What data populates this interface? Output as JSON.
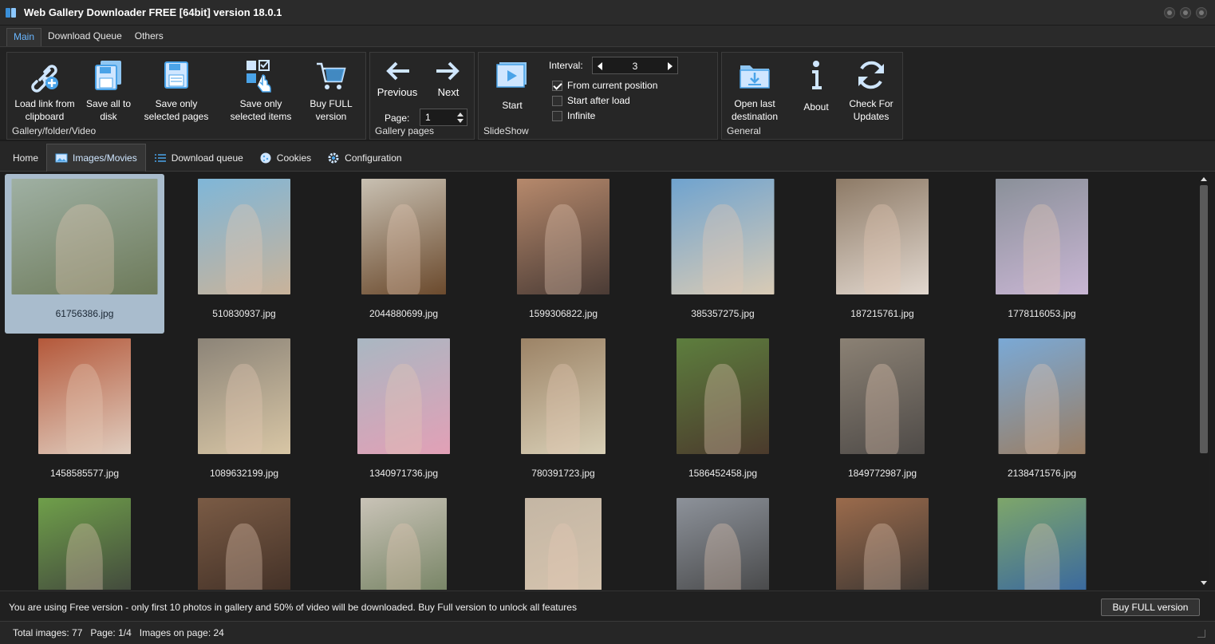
{
  "window": {
    "title": "Web Gallery Downloader FREE [64bit] version 18.0.1"
  },
  "ribbon_tabs": [
    {
      "label": "Main",
      "active": true
    },
    {
      "label": "Download Queue",
      "active": false
    },
    {
      "label": "Others",
      "active": false
    }
  ],
  "ribbon": {
    "gallery_group": {
      "label": "Gallery/folder/Video",
      "load_link": "Load link from clipboard",
      "save_all_1": "Save all to",
      "save_all_2": "disk",
      "save_pages_1": "Save only",
      "save_pages_2": "selected pages",
      "save_items_1": "Save only",
      "save_items_2": "selected items",
      "buy_full_1": "Buy FULL",
      "buy_full_2": "version",
      "load_link_1": "Load link from",
      "load_link_2": "clipboard"
    },
    "pages_group": {
      "label": "Gallery pages",
      "previous": "Previous",
      "next": "Next",
      "page_label": "Page:",
      "page_value": "1"
    },
    "slideshow_group": {
      "label": "SlideShow",
      "start": "Start",
      "interval_label": "Interval:",
      "interval_value": "3",
      "from_current": "From current position",
      "from_current_checked": true,
      "start_after_load": "Start after load",
      "start_after_load_checked": false,
      "infinite": "Infinite",
      "infinite_checked": false
    },
    "general_group": {
      "label": "General",
      "open_last_1": "Open last",
      "open_last_2": "destination",
      "about": "About",
      "check_updates_1": "Check For",
      "check_updates_2": "Updates"
    }
  },
  "content_tabs": [
    {
      "label": "Home",
      "icon": "none",
      "active": false
    },
    {
      "label": "Images/Movies",
      "icon": "image-icon",
      "active": true
    },
    {
      "label": "Download queue",
      "icon": "list-icon",
      "active": false
    },
    {
      "label": "Cookies",
      "icon": "cookie-icon",
      "active": false
    },
    {
      "label": "Configuration",
      "icon": "gear-icon",
      "active": false
    }
  ],
  "gallery": {
    "rows": [
      [
        {
          "file": "61756386.jpg",
          "selected": true,
          "colors": [
            "#9fb0a3",
            "#6d7a5a"
          ]
        },
        {
          "file": "510830937.jpg",
          "selected": false,
          "colors": [
            "#7fb6d8",
            "#c9b39a"
          ]
        },
        {
          "file": "2044880699.jpg",
          "selected": false,
          "colors": [
            "#c8c0b2",
            "#6b4a2d"
          ]
        },
        {
          "file": "1599306822.jpg",
          "selected": false,
          "colors": [
            "#b6896c",
            "#4a3b35"
          ]
        },
        {
          "file": "385357275.jpg",
          "selected": false,
          "colors": [
            "#6fa3cf",
            "#d9cbb5"
          ]
        },
        {
          "file": "187215761.jpg",
          "selected": false,
          "colors": [
            "#8d7a66",
            "#e2d8cf"
          ]
        },
        {
          "file": "1778116053.jpg",
          "selected": false,
          "colors": [
            "#8a9099",
            "#c9b6d4"
          ]
        }
      ],
      [
        {
          "file": "1458585577.jpg",
          "selected": false,
          "colors": [
            "#b4583a",
            "#e0cdbf"
          ]
        },
        {
          "file": "1089632199.jpg",
          "selected": false,
          "colors": [
            "#8c8478",
            "#d8c6a5"
          ]
        },
        {
          "file": "1340971736.jpg",
          "selected": false,
          "colors": [
            "#a9b7c2",
            "#e2a0b6"
          ]
        },
        {
          "file": "780391723.jpg",
          "selected": false,
          "colors": [
            "#9c8366",
            "#d8cfb6"
          ]
        },
        {
          "file": "1586452458.jpg",
          "selected": false,
          "colors": [
            "#5d7e3e",
            "#4b3a2c"
          ]
        },
        {
          "file": "1849772987.jpg",
          "selected": false,
          "colors": [
            "#8b8174",
            "#4f4b48"
          ]
        },
        {
          "file": "2138471576.jpg",
          "selected": false,
          "colors": [
            "#7aa9d6",
            "#9a7e64"
          ]
        }
      ],
      [
        {
          "file": "",
          "selected": false,
          "colors": [
            "#6f9f4a",
            "#3b3b3b"
          ]
        },
        {
          "file": "",
          "selected": false,
          "colors": [
            "#7a5b45",
            "#3a2a22"
          ]
        },
        {
          "file": "",
          "selected": false,
          "colors": [
            "#c9c3b7",
            "#6a7a58"
          ]
        },
        {
          "file": "",
          "selected": false,
          "colors": [
            "#c4b6a4",
            "#d8c6b0"
          ]
        },
        {
          "file": "",
          "selected": false,
          "colors": [
            "#8d929a",
            "#3d3d3d"
          ]
        },
        {
          "file": "",
          "selected": false,
          "colors": [
            "#9b6b4c",
            "#2e2e2e"
          ]
        },
        {
          "file": "",
          "selected": false,
          "colors": [
            "#7ea66a",
            "#2e5ea8"
          ]
        }
      ]
    ]
  },
  "notice": {
    "text": "You are using Free version - only first 10 photos in gallery and 50% of video will be downloaded. Buy Full version to unlock all features",
    "button": "Buy FULL version"
  },
  "status": {
    "total": "Total images: 77",
    "page": "Page: 1/4",
    "on_page": "Images on page: 24"
  },
  "colors": {
    "accent": "#69b6ff",
    "icon_blue": "#4aa3e8",
    "selection": "#a9bccd"
  }
}
